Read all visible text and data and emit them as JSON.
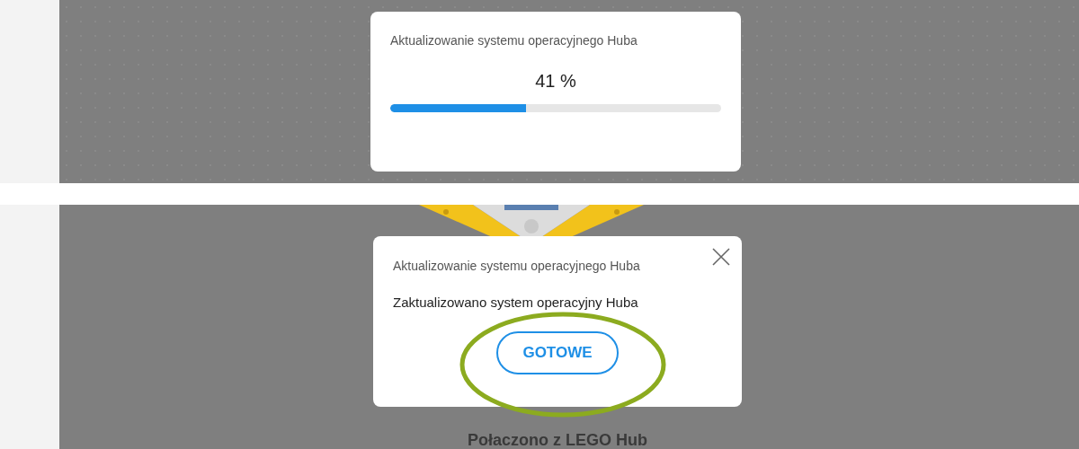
{
  "screens": [
    {
      "kind": "progress",
      "dialog": {
        "title": "Aktualizowanie systemu operacyjnego Huba",
        "percent": "41 %",
        "progress": {
          "level": 0.41
        }
      }
    },
    {
      "kind": "done",
      "dialog": {
        "title": "Aktualizowanie systemu operacyjnego Huba",
        "message": "Zaktualizowano system operacyjny Huba",
        "button": "GOTOWE",
        "highlighted": true
      },
      "status": "Połaczono z LEGO Hub"
    }
  ]
}
